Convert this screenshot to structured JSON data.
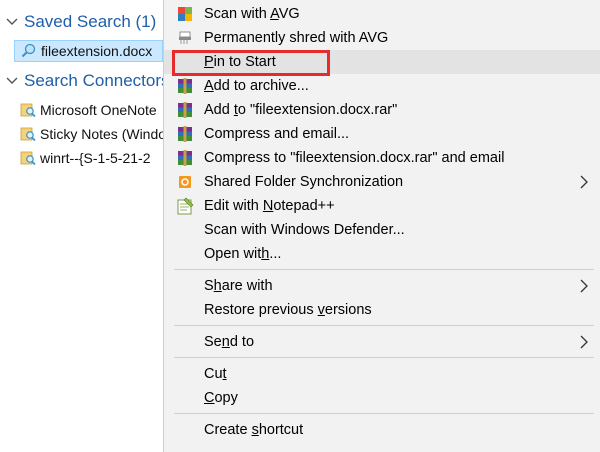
{
  "nav": {
    "groups": [
      {
        "label": "Saved Search (1)"
      },
      {
        "label": "Search Connectors"
      }
    ],
    "items": [
      {
        "label": "fileextension.docx",
        "selected": true,
        "icon": "saved-search-icon"
      },
      {
        "label": "Microsoft OneNote",
        "icon": "search-connector-icon"
      },
      {
        "label": "Sticky Notes (Windows)",
        "icon": "search-connector-icon"
      },
      {
        "label": "winrt--{S-1-5-21-2",
        "icon": "search-connector-icon"
      }
    ]
  },
  "menu": {
    "items": [
      {
        "key": "scan_avg",
        "pre": "Scan with ",
        "acc": "A",
        "post": "VG",
        "icon": "avg-icon"
      },
      {
        "key": "shred_avg",
        "pre": "Permanently shred with AVG",
        "acc": "",
        "post": "",
        "icon": "shredder-icon"
      },
      {
        "key": "pin_start",
        "pre": "",
        "acc": "P",
        "post": "in to Start",
        "icon": "",
        "highlighted": true
      },
      {
        "key": "add_archive",
        "pre": "",
        "acc": "A",
        "post": "dd to archive...",
        "icon": "winrar-icon"
      },
      {
        "key": "add_rar",
        "pre": "Add ",
        "acc": "t",
        "post": "o \"fileextension.docx.rar\"",
        "icon": "winrar-icon"
      },
      {
        "key": "compress_email",
        "pre": "Compress and email...",
        "acc": "",
        "post": "",
        "icon": "winrar-icon"
      },
      {
        "key": "compress_rar_email",
        "pre": "Compress to \"fileextension.docx.rar\" and email",
        "acc": "",
        "post": "",
        "icon": "winrar-icon"
      },
      {
        "key": "shared_sync",
        "pre": "Shared Folder Synchronization",
        "acc": "",
        "post": "",
        "icon": "sync-icon",
        "submenu": true
      },
      {
        "key": "edit_npp",
        "pre": "Edit with ",
        "acc": "N",
        "post": "otepad++",
        "icon": "notepadpp-icon"
      },
      {
        "key": "scan_defender",
        "pre": "Scan with Windows Defender...",
        "acc": "",
        "post": "",
        "icon": ""
      },
      {
        "key": "open_with",
        "pre": "Open wit",
        "acc": "h",
        "post": "...",
        "icon": ""
      },
      {
        "key": "share_with",
        "pre": "S",
        "acc": "h",
        "post": "are with",
        "icon": "",
        "submenu": true
      },
      {
        "key": "restore_versions",
        "pre": "Restore previous ",
        "acc": "v",
        "post": "ersions",
        "icon": ""
      },
      {
        "key": "send_to",
        "pre": "Se",
        "acc": "n",
        "post": "d to",
        "icon": "",
        "submenu": true
      },
      {
        "key": "cut",
        "pre": "Cu",
        "acc": "t",
        "post": "",
        "icon": ""
      },
      {
        "key": "copy",
        "pre": "",
        "acc": "C",
        "post": "opy",
        "icon": ""
      },
      {
        "key": "create_shortcut",
        "pre": "Create ",
        "acc": "s",
        "post": "hortcut",
        "icon": ""
      }
    ]
  },
  "colors": {
    "accent_blue": "#1f5ea8",
    "highlight_red": "#e52b2b",
    "menu_bg": "#f2f2f2",
    "selection_bg": "#cce8ff"
  }
}
